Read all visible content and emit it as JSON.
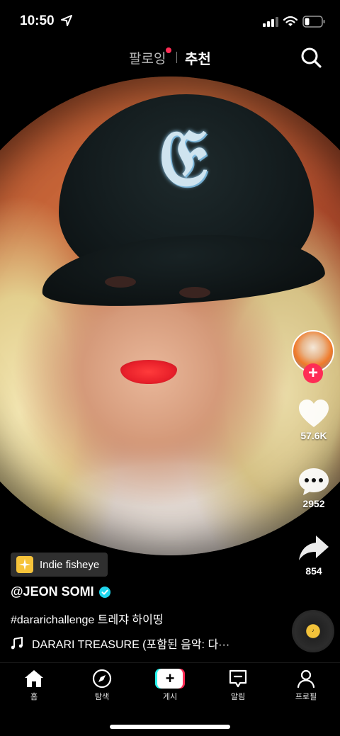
{
  "status_bar": {
    "time": "10:50"
  },
  "top_tabs": {
    "following": "팔로잉",
    "for_you": "추천"
  },
  "effect": {
    "label": "Indie fisheye"
  },
  "post": {
    "username": "@JEON SOMI",
    "caption": "#dararichallenge 트레쟈 하이띵",
    "music": "DARARI TREASURE (포함된 음악: 다···"
  },
  "rail": {
    "likes": "57.6K",
    "comments": "2952",
    "shares": "854"
  },
  "nav": {
    "home": "홈",
    "explore": "탐색",
    "post": "게시",
    "inbox": "알림",
    "profile": "프로필"
  },
  "colors": {
    "accent": "#fe2c55",
    "cyan": "#25f4ee",
    "verified": "#20d5ec"
  },
  "icons": [
    "location-arrow-icon",
    "signal-icon",
    "wifi-icon",
    "battery-icon",
    "search-icon",
    "heart-icon",
    "comment-icon",
    "share-icon",
    "music-note-icon",
    "home-icon",
    "compass-icon",
    "inbox-icon",
    "profile-icon"
  ]
}
